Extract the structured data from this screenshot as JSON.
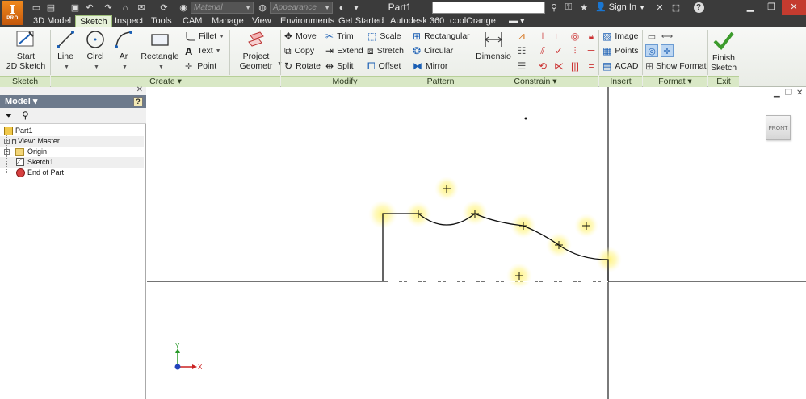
{
  "app": {
    "logo_text": "I",
    "logo_badge": "PRO",
    "document_title": "Part1",
    "material_placeholder": "Material",
    "appearance_placeholder": "Appearance",
    "sign_in": "Sign In",
    "help_symbol": "?"
  },
  "tabs": [
    {
      "label": "3D Model",
      "active": false
    },
    {
      "label": "Sketch",
      "active": true
    },
    {
      "label": "Inspect",
      "active": false
    },
    {
      "label": "Tools",
      "active": false
    },
    {
      "label": "CAM",
      "active": false
    },
    {
      "label": "Manage",
      "active": false
    },
    {
      "label": "View",
      "active": false
    },
    {
      "label": "Environments",
      "active": false
    },
    {
      "label": "Get Started",
      "active": false
    },
    {
      "label": "Autodesk 360",
      "active": false
    },
    {
      "label": "coolOrange",
      "active": false
    }
  ],
  "ribbon": {
    "sketch_group": {
      "label": "Sketch",
      "start_sketch": "Start\n2D Sketch"
    },
    "create_group": {
      "label": "Create ▾",
      "line": "Line",
      "circle": "Circl",
      "arc": "Ar",
      "rectangle": "Rectangle",
      "fillet": "Fillet",
      "text": "Text",
      "point": "Point"
    },
    "project_geometry": "Project\nGeometr",
    "modify_group": {
      "label": "Modify",
      "move": "Move",
      "copy": "Copy",
      "rotate": "Rotate",
      "trim": "Trim",
      "extend": "Extend",
      "split": "Split",
      "scale": "Scale",
      "stretch": "Stretch",
      "offset": "Offset"
    },
    "pattern_group": {
      "label": "Pattern",
      "rectangular": "Rectangular",
      "circular": "Circular",
      "mirror": "Mirror"
    },
    "constrain_group": {
      "label": "Constrain ▾",
      "dimension": "Dimensio"
    },
    "insert_group": {
      "label": "Insert",
      "image": "Image",
      "points": "Points",
      "acad": "ACAD"
    },
    "format_group": {
      "label": "Format ▾",
      "show_format": "Show Format"
    },
    "exit_group": {
      "label": "Exit",
      "finish_sketch": "Finish\nSketch"
    }
  },
  "browser": {
    "title": "Model ▾",
    "help": "?",
    "tree": [
      {
        "label": "Part1",
        "icon": "part-icon"
      },
      {
        "label": "View: Master",
        "icon": "view-icon"
      },
      {
        "label": "Origin",
        "icon": "folder-icon"
      },
      {
        "label": "Sketch1",
        "icon": "sketch-icon"
      },
      {
        "label": "End of Part",
        "icon": "end-of-part-icon"
      }
    ]
  },
  "viewcube": {
    "face": "FRONT"
  },
  "triad": {
    "x": "X",
    "y": "Y"
  },
  "colors": {
    "title_bar": "#3b3b3b",
    "ribbon_footer": "#d9e8c6",
    "active_tab": "#e6f1d9",
    "browser_header": "#6d7a8c",
    "constraint_glow": "#fff27a"
  }
}
